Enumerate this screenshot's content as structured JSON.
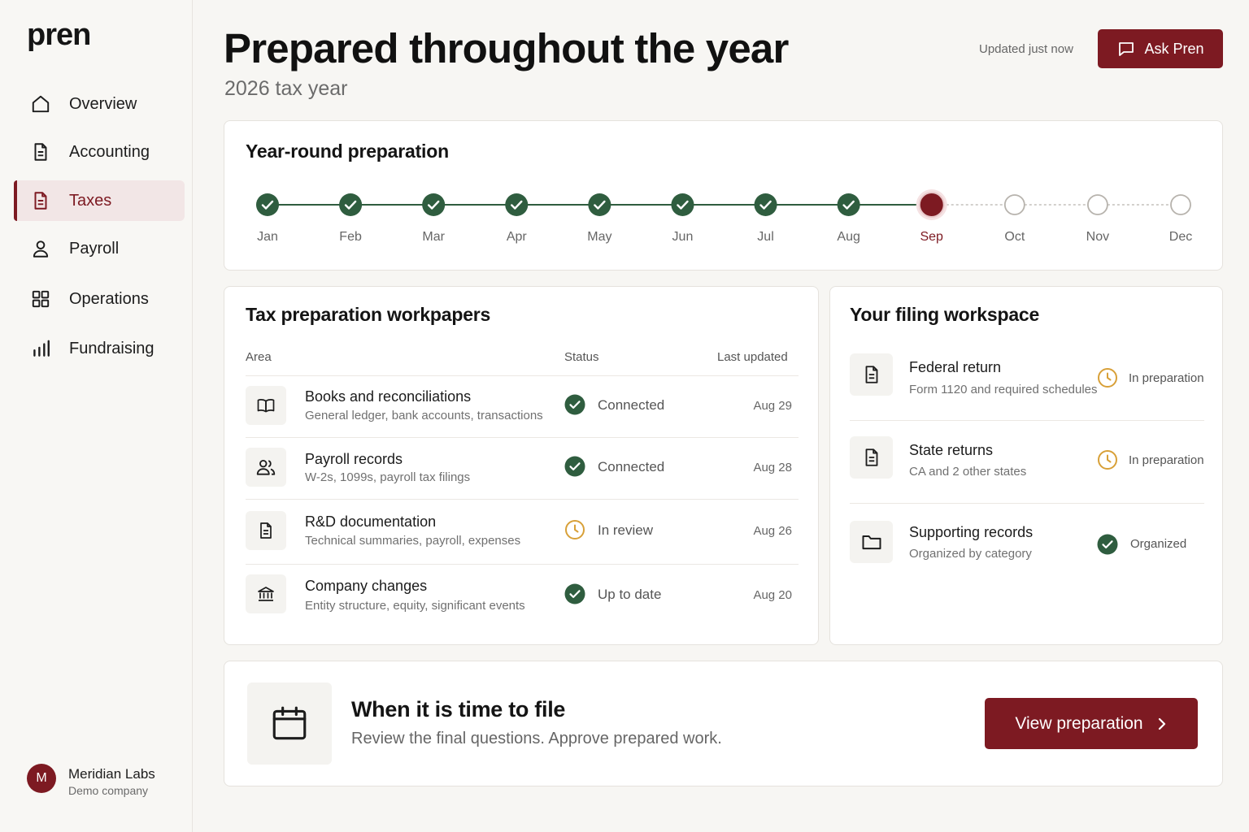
{
  "app": {
    "logo": "pren"
  },
  "sidebar": {
    "items": [
      {
        "label": "Overview",
        "icon": "home-icon"
      },
      {
        "label": "Accounting",
        "icon": "document-icon"
      },
      {
        "label": "Taxes",
        "icon": "document-icon",
        "active": true
      },
      {
        "label": "Payroll",
        "icon": "user-icon"
      },
      {
        "label": "Operations",
        "icon": "grid-icon"
      },
      {
        "label": "Fundraising",
        "icon": "bar-chart-icon"
      }
    ],
    "company": {
      "initial": "M",
      "name": "Meridian Labs",
      "subtitle": "Demo company"
    }
  },
  "header": {
    "title": "Prepared throughout the year",
    "subtitle": "2026 tax year",
    "updated": "Updated just now",
    "ask_label": "Ask Pren"
  },
  "timeline": {
    "title": "Year-round preparation",
    "months": [
      {
        "label": "Jan",
        "state": "done"
      },
      {
        "label": "Feb",
        "state": "done"
      },
      {
        "label": "Mar",
        "state": "done"
      },
      {
        "label": "Apr",
        "state": "done"
      },
      {
        "label": "May",
        "state": "done"
      },
      {
        "label": "Jun",
        "state": "done"
      },
      {
        "label": "Jul",
        "state": "done"
      },
      {
        "label": "Aug",
        "state": "done"
      },
      {
        "label": "Sep",
        "state": "current"
      },
      {
        "label": "Oct",
        "state": "upcoming"
      },
      {
        "label": "Nov",
        "state": "upcoming"
      },
      {
        "label": "Dec",
        "state": "upcoming"
      }
    ]
  },
  "workpapers": {
    "title": "Tax preparation workpapers",
    "columns": {
      "area": "Area",
      "status": "Status",
      "updated": "Last updated"
    },
    "rows": [
      {
        "title": "Books and reconciliations",
        "desc": "General ledger, bank accounts, transactions",
        "status": "Connected",
        "status_type": "ok",
        "date": "Aug 29",
        "icon": "book-icon"
      },
      {
        "title": "Payroll records",
        "desc": "W-2s, 1099s, payroll tax filings",
        "status": "Connected",
        "status_type": "ok",
        "date": "Aug 28",
        "icon": "users-icon"
      },
      {
        "title": "R&D documentation",
        "desc": "Technical summaries, payroll, expenses",
        "status": "In review",
        "status_type": "pending",
        "date": "Aug 26",
        "icon": "document-icon"
      },
      {
        "title": "Company changes",
        "desc": "Entity structure, equity, significant events",
        "status": "Up to date",
        "status_type": "ok",
        "date": "Aug 20",
        "icon": "bank-icon"
      }
    ]
  },
  "workspace": {
    "title": "Your filing workspace",
    "items": [
      {
        "title": "Federal return",
        "desc": "Form 1120 and required schedules",
        "status": "In preparation",
        "status_type": "pending",
        "icon": "document-icon"
      },
      {
        "title": "State returns",
        "desc": "CA and 2 other states",
        "status": "In preparation",
        "status_type": "pending",
        "icon": "document-icon"
      },
      {
        "title": "Supporting records",
        "desc": "Organized by category",
        "status": "Organized",
        "status_type": "ok",
        "icon": "folder-icon"
      }
    ]
  },
  "filing": {
    "title": "When it is time to file",
    "subtitle": "Review the final questions. Approve prepared work.",
    "button": "View preparation"
  },
  "colors": {
    "brand": "#7d1a22",
    "success": "#2f5d3f",
    "pending": "#d8a038",
    "upcoming": "#b7b3ad"
  }
}
